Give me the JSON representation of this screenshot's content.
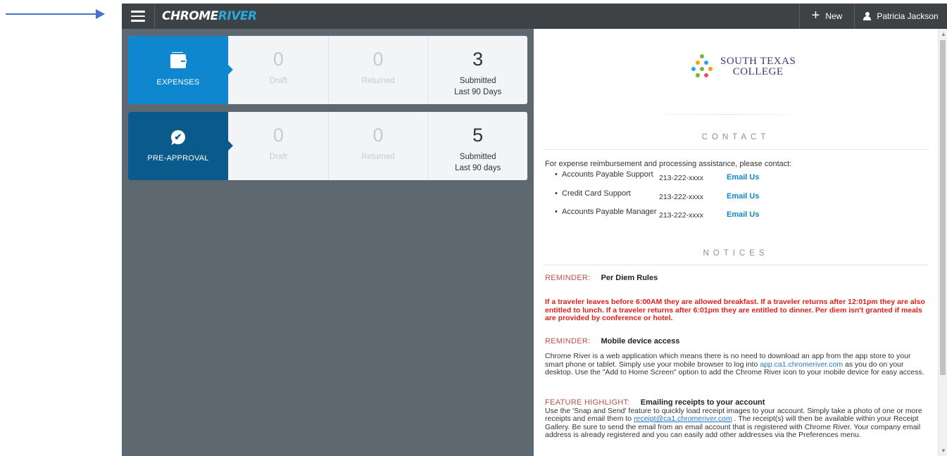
{
  "header": {
    "logo_left": "CHROME",
    "logo_right": "RIVER",
    "new_label": "New",
    "user_name": "Patricia Jackson"
  },
  "cards": {
    "expenses": {
      "label": "EXPENSES",
      "draft_count": "0",
      "draft_label": "Draft",
      "returned_count": "0",
      "returned_label": "Returned",
      "submitted_count": "3",
      "submitted_label": "Submitted",
      "submitted_period": "Last 90 Days"
    },
    "preapproval": {
      "label": "PRE-APPROVAL",
      "draft_count": "0",
      "draft_label": "Draft",
      "returned_count": "0",
      "returned_label": "Returned",
      "submitted_count": "5",
      "submitted_label": "Submitted",
      "submitted_period": "Last 90 days"
    }
  },
  "college": {
    "line1": "SOUTH TEXAS",
    "line2": "COLLEGE"
  },
  "contact": {
    "title": "CONTACT",
    "intro": "For expense reimbursement and processing assistance, please contact:",
    "rows": [
      {
        "name": "Accounts Payable Support",
        "phone": "213-222-xxxx",
        "email": "Email Us"
      },
      {
        "name": "Credit Card Support",
        "phone": "213-222-xxxx",
        "email": "Email Us"
      },
      {
        "name": "Accounts Payable Manager",
        "phone": "213-222-xxxx",
        "email": "Email Us"
      }
    ]
  },
  "notices": {
    "title": "NOTICES",
    "n1_tag": "REMINDER:",
    "n1_title": "Per Diem Rules",
    "n1_body": "If a traveler leaves before 6:00AM they are allowed breakfast. If a traveler returns after 12:01pm they are also entitled to lunch. If a traveler returns after 6:01pm they are entitled to dinner. Per diem isn't granted if meals are provided by conference or hotel.",
    "n2_tag": "REMINDER:",
    "n2_title": "Mobile device access",
    "n2_body_a": "Chrome River is a web application which means there is no need to download an app from the app store to your smart phone or tablet.  Simply use your mobile browser to log into ",
    "n2_link": "app.ca1.chromeriver.com",
    "n2_body_b": "  as you do on your desktop.  Use the \"Add to Home Screen\" option to add the Chrome River icon to your mobile device for easy access.",
    "n3_tag": "FEATURE HIGHLIGHT:",
    "n3_title": "Emailing receipts to your account",
    "n3_body_a": "Use the 'Snap and Send' feature to quickly load receipt images to your account.  Simply take a photo of one or more receipts and email them to ",
    "n3_link": "receipt@ca1.chromeriver.com",
    "n3_body_b": " .  The receipt(s) will then be available within your Receipt Gallery.  Be sure to send the email from an email account that is registered with Chrome River.  Your company email address is already registered and you can easily add other addresses via the Preferences menu."
  },
  "colors": {
    "topbar": "#3d4246",
    "workspace": "#5d6870",
    "expenses_tile": "#0f87cf",
    "preapproval_tile": "#0a5b8c",
    "reminder_tag": "#c0504d",
    "alert_text": "#e0201c",
    "link": "#0f87cf"
  },
  "icons": [
    "menu-icon",
    "plus-icon",
    "user-icon",
    "wallet-icon",
    "check-bubble-icon",
    "college-people-logo",
    "scroll-up-arrow",
    "scroll-down-arrow"
  ]
}
